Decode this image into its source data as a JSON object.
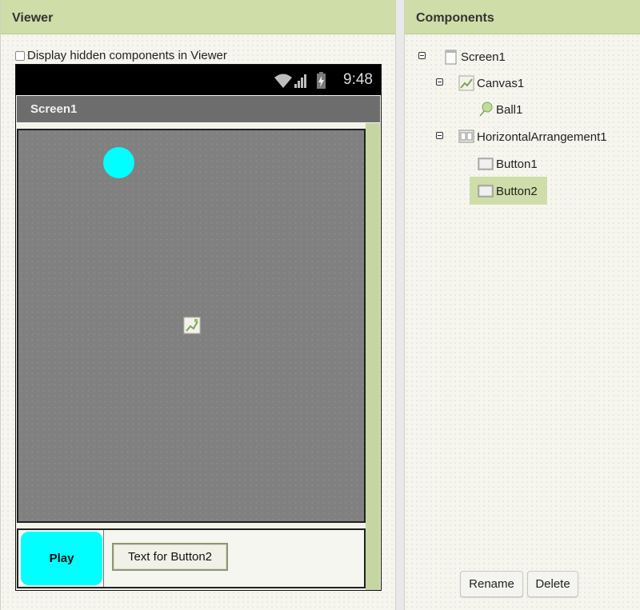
{
  "viewer": {
    "title": "Viewer",
    "display_hidden_label": "Display hidden components in Viewer",
    "display_hidden_checked": false,
    "phone": {
      "status_time": "9:48",
      "status_icons": [
        "wifi-icon",
        "signal-icon",
        "battery-icon"
      ],
      "screen_title": "Screen1",
      "canvas": {
        "background": "#808080",
        "ball_color": "#00ffff"
      },
      "buttons": [
        {
          "label": "Play",
          "color": "#00ffff"
        },
        {
          "label": "Text for Button2"
        }
      ]
    }
  },
  "components": {
    "title": "Components",
    "tree": [
      {
        "label": "Screen1",
        "icon": "screen-icon"
      },
      {
        "label": "Canvas1",
        "icon": "canvas-icon"
      },
      {
        "label": "Ball1",
        "icon": "ball-icon"
      },
      {
        "label": "HorizontalArrangement1",
        "icon": "horizontal-arrangement-icon"
      },
      {
        "label": "Button1",
        "icon": "button-icon"
      },
      {
        "label": "Button2",
        "icon": "button-icon",
        "selected": true
      }
    ],
    "rename_label": "Rename",
    "delete_label": "Delete"
  },
  "colors": {
    "header_green": "#cfdda9",
    "selection_green": "#cfdda9"
  }
}
